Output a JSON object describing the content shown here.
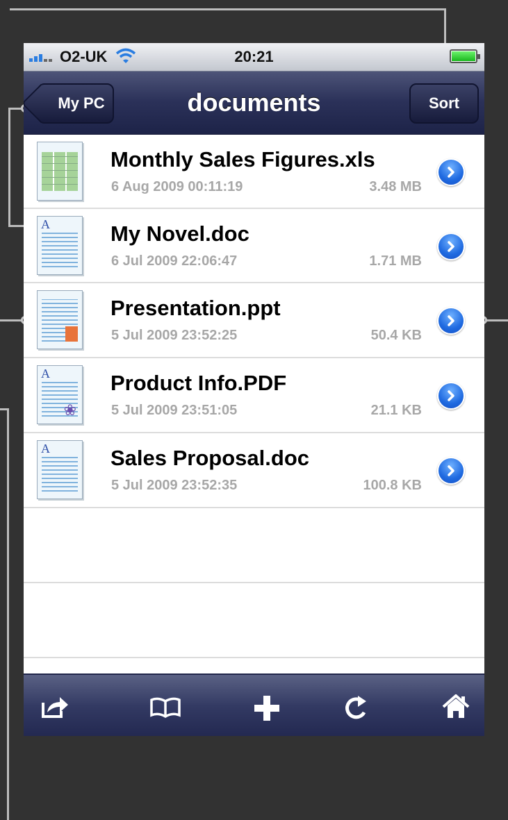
{
  "status_bar": {
    "carrier": "O2-UK",
    "time": "20:21"
  },
  "nav": {
    "title": "documents",
    "back_label": "My PC",
    "sort_label": "Sort"
  },
  "files": [
    {
      "name": "Monthly Sales Figures.xls",
      "date": "6 Aug 2009 00:11:19",
      "size": "3.48 MB",
      "icon": "spreadsheet-icon"
    },
    {
      "name": "My Novel.doc",
      "date": "6 Jul 2009 22:06:47",
      "size": "1.71 MB",
      "icon": "document-icon"
    },
    {
      "name": "Presentation.ppt",
      "date": "5 Jul 2009 23:52:25",
      "size": "50.4 KB",
      "icon": "presentation-icon"
    },
    {
      "name": "Product Info.PDF",
      "date": "5 Jul 2009 23:51:05",
      "size": "21.1 KB",
      "icon": "pdf-icon"
    },
    {
      "name": "Sales Proposal.doc",
      "date": "5 Jul 2009 23:52:35",
      "size": "100.8 KB",
      "icon": "document-icon"
    }
  ],
  "toolbar": [
    {
      "icon": "share-icon"
    },
    {
      "icon": "bookmarks-icon"
    },
    {
      "icon": "add-icon"
    },
    {
      "icon": "refresh-icon"
    },
    {
      "icon": "home-icon"
    }
  ],
  "colors": {
    "background": "#323232",
    "navbar": "#2b3159",
    "accent_blue": "#1f6ae0",
    "meta_text": "#a7a7a7"
  }
}
